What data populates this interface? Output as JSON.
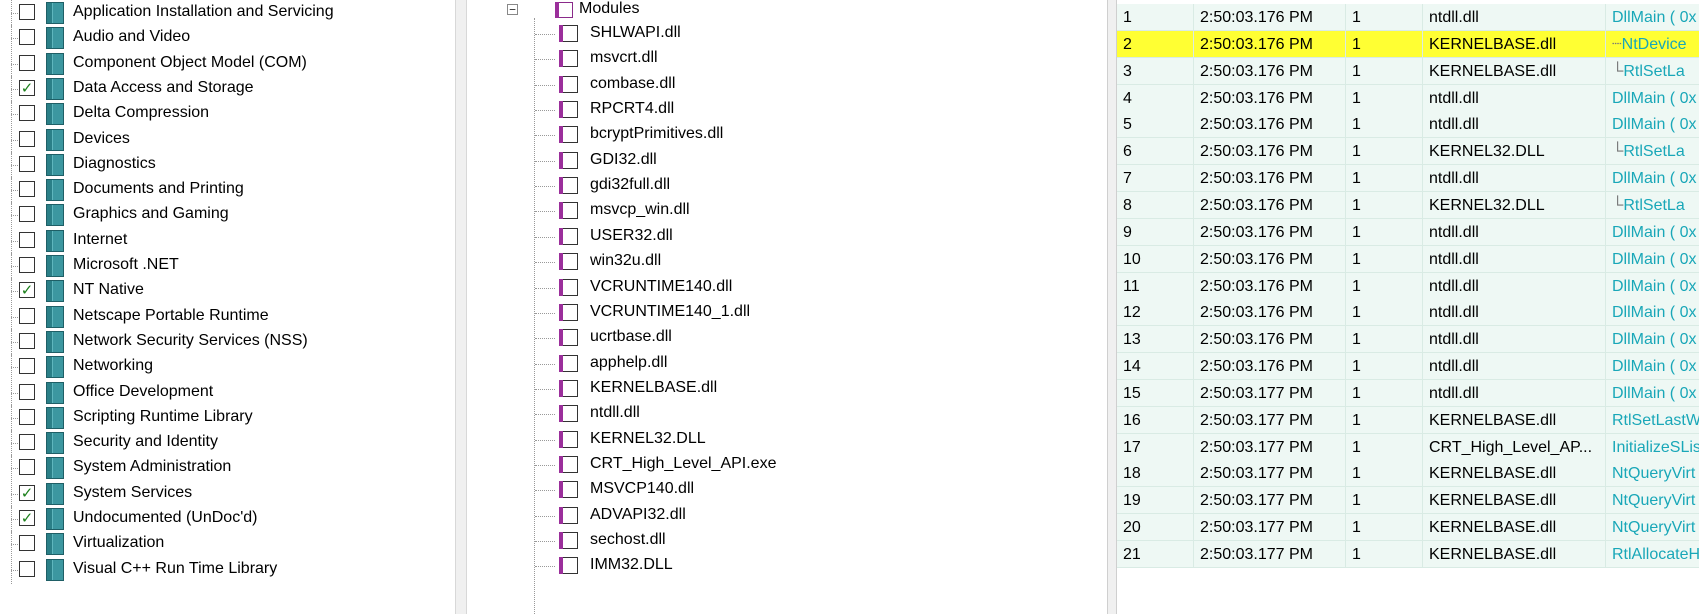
{
  "filter_tree": {
    "categories": [
      {
        "label": "Application Installation and Servicing",
        "checked": false
      },
      {
        "label": "Audio and Video",
        "checked": false
      },
      {
        "label": "Component Object Model (COM)",
        "checked": false
      },
      {
        "label": "Data Access and Storage",
        "checked": true
      },
      {
        "label": "Delta Compression",
        "checked": false
      },
      {
        "label": "Devices",
        "checked": false
      },
      {
        "label": "Diagnostics",
        "checked": false
      },
      {
        "label": "Documents and Printing",
        "checked": false
      },
      {
        "label": "Graphics and Gaming",
        "checked": false
      },
      {
        "label": "Internet",
        "checked": false
      },
      {
        "label": "Microsoft .NET",
        "checked": false
      },
      {
        "label": "NT Native",
        "checked": true
      },
      {
        "label": "Netscape Portable Runtime",
        "checked": false
      },
      {
        "label": "Network Security Services (NSS)",
        "checked": false
      },
      {
        "label": "Networking",
        "checked": false
      },
      {
        "label": "Office Development",
        "checked": false
      },
      {
        "label": "Scripting Runtime Library",
        "checked": false
      },
      {
        "label": "Security and Identity",
        "checked": false
      },
      {
        "label": "System Administration",
        "checked": false
      },
      {
        "label": "System Services",
        "checked": true
      },
      {
        "label": "Undocumented (UnDoc'd)",
        "checked": true
      },
      {
        "label": "Virtualization",
        "checked": false
      },
      {
        "label": "Visual C++ Run Time Library",
        "checked": false
      }
    ],
    "check_glyph": "✓"
  },
  "modules_tree": {
    "expander_glyph": "−",
    "title": "Modules",
    "items": [
      "SHLWAPI.dll",
      "msvcrt.dll",
      "combase.dll",
      "RPCRT4.dll",
      "bcryptPrimitives.dll",
      "GDI32.dll",
      "gdi32full.dll",
      "msvcp_win.dll",
      "USER32.dll",
      "win32u.dll",
      "VCRUNTIME140.dll",
      "VCRUNTIME140_1.dll",
      "ucrtbase.dll",
      "apphelp.dll",
      "KERNELBASE.dll",
      "ntdll.dll",
      "KERNEL32.DLL",
      "CRT_High_Level_API.exe",
      "MSVCP140.dll",
      "ADVAPI32.dll",
      "sechost.dll",
      "IMM32.DLL"
    ]
  },
  "summary_grid": {
    "rows": [
      {
        "num": "1",
        "time": "2:50:03.176 PM",
        "thread": "1",
        "module": "ntdll.dll",
        "api": "DllMain ( 0x",
        "indent": ""
      },
      {
        "num": "2",
        "time": "2:50:03.176 PM",
        "thread": "1",
        "module": "KERNELBASE.dll",
        "api": "NtDevice",
        "indent": "┈",
        "selected": true
      },
      {
        "num": "3",
        "time": "2:50:03.176 PM",
        "thread": "1",
        "module": "KERNELBASE.dll",
        "api": "RtlSetLa",
        "indent": "└"
      },
      {
        "num": "4",
        "time": "2:50:03.176 PM",
        "thread": "1",
        "module": "ntdll.dll",
        "api": "DllMain ( 0x",
        "indent": ""
      },
      {
        "num": "5",
        "time": "2:50:03.176 PM",
        "thread": "1",
        "module": "ntdll.dll",
        "api": "DllMain ( 0x",
        "indent": ""
      },
      {
        "num": "6",
        "time": "2:50:03.176 PM",
        "thread": "1",
        "module": "KERNEL32.DLL",
        "api": "RtlSetLa",
        "indent": "└"
      },
      {
        "num": "7",
        "time": "2:50:03.176 PM",
        "thread": "1",
        "module": "ntdll.dll",
        "api": "DllMain ( 0x",
        "indent": ""
      },
      {
        "num": "8",
        "time": "2:50:03.176 PM",
        "thread": "1",
        "module": "KERNEL32.DLL",
        "api": "RtlSetLa",
        "indent": "└"
      },
      {
        "num": "9",
        "time": "2:50:03.176 PM",
        "thread": "1",
        "module": "ntdll.dll",
        "api": "DllMain ( 0x",
        "indent": ""
      },
      {
        "num": "10",
        "time": "2:50:03.176 PM",
        "thread": "1",
        "module": "ntdll.dll",
        "api": "DllMain ( 0x",
        "indent": ""
      },
      {
        "num": "11",
        "time": "2:50:03.176 PM",
        "thread": "1",
        "module": "ntdll.dll",
        "api": "DllMain ( 0x",
        "indent": ""
      },
      {
        "num": "12",
        "time": "2:50:03.176 PM",
        "thread": "1",
        "module": "ntdll.dll",
        "api": "DllMain ( 0x",
        "indent": ""
      },
      {
        "num": "13",
        "time": "2:50:03.176 PM",
        "thread": "1",
        "module": "ntdll.dll",
        "api": "DllMain ( 0x",
        "indent": ""
      },
      {
        "num": "14",
        "time": "2:50:03.176 PM",
        "thread": "1",
        "module": "ntdll.dll",
        "api": "DllMain ( 0x",
        "indent": ""
      },
      {
        "num": "15",
        "time": "2:50:03.177 PM",
        "thread": "1",
        "module": "ntdll.dll",
        "api": "DllMain ( 0x",
        "indent": ""
      },
      {
        "num": "16",
        "time": "2:50:03.177 PM",
        "thread": "1",
        "module": "KERNELBASE.dll",
        "api": "RtlSetLastW",
        "indent": ""
      },
      {
        "num": "17",
        "time": "2:50:03.177 PM",
        "thread": "1",
        "module": "CRT_High_Level_AP...",
        "api": "InitializeSLis",
        "indent": ""
      },
      {
        "num": "18",
        "time": "2:50:03.177 PM",
        "thread": "1",
        "module": "KERNELBASE.dll",
        "api": "NtQueryVirt",
        "indent": ""
      },
      {
        "num": "19",
        "time": "2:50:03.177 PM",
        "thread": "1",
        "module": "KERNELBASE.dll",
        "api": "NtQueryVirt",
        "indent": ""
      },
      {
        "num": "20",
        "time": "2:50:03.177 PM",
        "thread": "1",
        "module": "KERNELBASE.dll",
        "api": "NtQueryVirt",
        "indent": ""
      },
      {
        "num": "21",
        "time": "2:50:03.177 PM",
        "thread": "1",
        "module": "KERNELBASE.dll",
        "api": "RtlAllocateH",
        "indent": ""
      }
    ]
  },
  "icons": {
    "category": "api-category-book-icon",
    "module": "module-icon",
    "modules_folder": "modules-folder-icon"
  },
  "colors": {
    "selected_row": "#ffff33",
    "grid_row": "#eef8f4",
    "api_text": "#19a7b8",
    "check": "#1a7f1a"
  }
}
